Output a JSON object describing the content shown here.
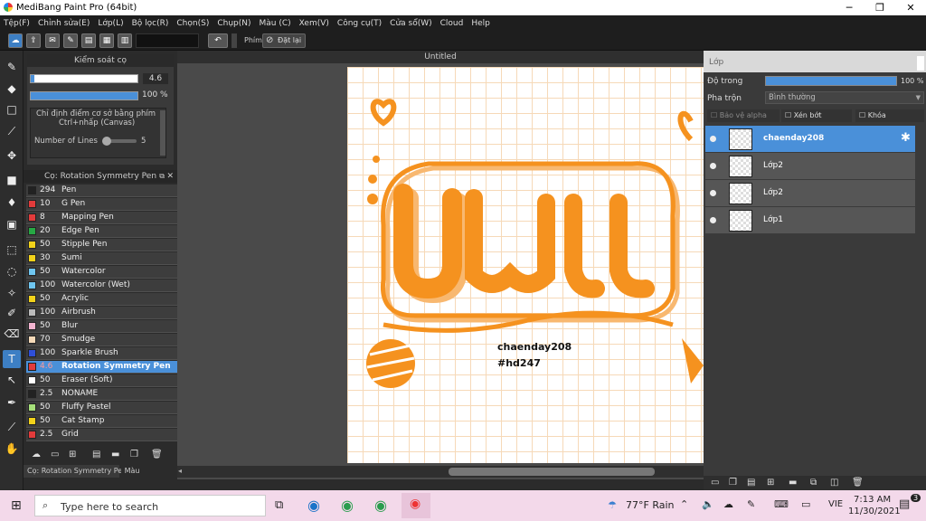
{
  "window": {
    "title": "MediBang Paint Pro (64bit)",
    "minimize": "─",
    "maximize": "❐",
    "close": "✕"
  },
  "menu": [
    "Tệp(F)",
    "Chỉnh sửa(E)",
    "Lớp(L)",
    "Bộ lọc(R)",
    "Chọn(S)",
    "Chụp(N)",
    "Màu (C)",
    "Xem(V)",
    "Công cụ(T)",
    "Cửa sổ(W)",
    "Cloud",
    "Help"
  ],
  "toolbar": {
    "phim_label": "Phím",
    "reset_label": "Đặt lại"
  },
  "brush_control": {
    "title": "Kiểm soát cọ",
    "size_value": "4.6",
    "opacity_value": "100 %",
    "opacity_fraction": 1.0,
    "size_fraction": 0.03,
    "hint_line1": "Chỉ định điểm cơ sở bằng phím",
    "hint_line2": "Ctrl+nhấp (Canvas)",
    "lines_label": "Number of Lines",
    "lines_value": "5"
  },
  "brush_panel": {
    "title": "Cọ: Rotation Symmetry Pen",
    "brushes": [
      {
        "size": "294",
        "name": "Pen",
        "color": "#222222"
      },
      {
        "size": "10",
        "name": "G Pen",
        "color": "#e23b3b"
      },
      {
        "size": "8",
        "name": "Mapping Pen",
        "color": "#e23b3b"
      },
      {
        "size": "20",
        "name": "Edge Pen",
        "color": "#27a844"
      },
      {
        "size": "50",
        "name": "Stipple Pen",
        "color": "#f2d21a"
      },
      {
        "size": "30",
        "name": "Sumi",
        "color": "#f2d21a"
      },
      {
        "size": "50",
        "name": "Watercolor",
        "color": "#6fc6f0"
      },
      {
        "size": "100",
        "name": "Watercolor (Wet)",
        "color": "#6fc6f0"
      },
      {
        "size": "50",
        "name": "Acrylic",
        "color": "#f2d21a"
      },
      {
        "size": "100",
        "name": "Airbrush",
        "color": "#bbbbbb"
      },
      {
        "size": "50",
        "name": "Blur",
        "color": "#f2b3cf"
      },
      {
        "size": "70",
        "name": "Smudge",
        "color": "#f5d9b8"
      },
      {
        "size": "100",
        "name": "Sparkle Brush",
        "color": "#2f4fd8"
      },
      {
        "size": "4.6",
        "name": "Rotation Symmetry Pen",
        "color": "#e23b3b"
      },
      {
        "size": "50",
        "name": "Eraser (Soft)",
        "color": "#ffffff"
      },
      {
        "size": "2.5",
        "name": "NONAME",
        "color": "#222222"
      },
      {
        "size": "50",
        "name": "Fluffy Pastel",
        "color": "#a6e07a"
      },
      {
        "size": "50",
        "name": "Cat Stamp",
        "color": "#f2d21a"
      },
      {
        "size": "2.5",
        "name": "Grid",
        "color": "#e23b3b"
      }
    ],
    "selected_index": 13
  },
  "bottom_tabs": [
    "Cọ: Rotation Symmetry Pen",
    "Màu"
  ],
  "document": {
    "tab": "Untitled",
    "text_line1": "chaenday208",
    "text_line2": "#hd247"
  },
  "layer_panel": {
    "title": "Lớp",
    "opacity_label": "Độ trong",
    "opacity_value": "100 %",
    "blend_label": "Pha trộn",
    "blend_value": "Bình thường",
    "protect_alpha": "Bảo vệ alpha",
    "clipping": "Xén bớt",
    "lock": "Khóa",
    "layers": [
      {
        "name": "chaenday208",
        "selected": true
      },
      {
        "name": "Lớp2",
        "selected": false
      },
      {
        "name": "Lớp2",
        "selected": false
      },
      {
        "name": "Lớp1",
        "selected": false
      }
    ]
  },
  "taskbar": {
    "search_placeholder": "Type here to search",
    "weather": "77°F  Rain",
    "lang": "VIE",
    "time": "7:13 AM",
    "date": "11/30/2021",
    "notif_count": "3"
  }
}
